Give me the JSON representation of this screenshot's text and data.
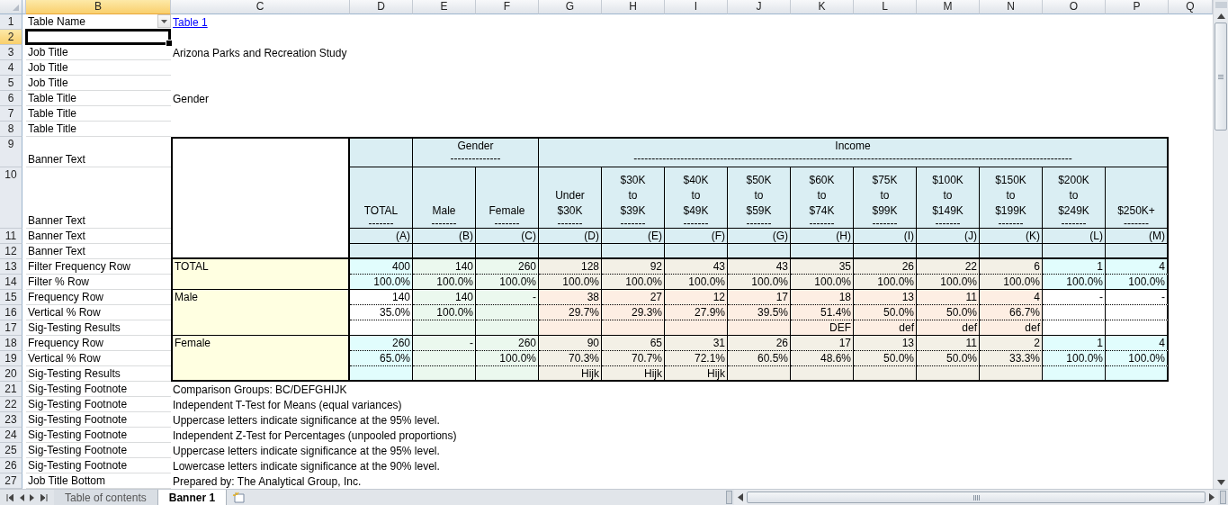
{
  "columns": [
    {
      "label": "B",
      "selected": true
    },
    {
      "label": "C",
      "selected": false
    },
    {
      "label": "D",
      "selected": false
    },
    {
      "label": "E",
      "selected": false
    },
    {
      "label": "F",
      "selected": false
    },
    {
      "label": "G",
      "selected": false
    },
    {
      "label": "H",
      "selected": false
    },
    {
      "label": "I",
      "selected": false
    },
    {
      "label": "J",
      "selected": false
    },
    {
      "label": "K",
      "selected": false
    },
    {
      "label": "L",
      "selected": false
    },
    {
      "label": "M",
      "selected": false
    },
    {
      "label": "N",
      "selected": false
    },
    {
      "label": "O",
      "selected": false
    },
    {
      "label": "P",
      "selected": false
    },
    {
      "label": "Q",
      "selected": false
    }
  ],
  "rows": [
    {
      "number": "1",
      "selected": false,
      "label": "Table Name",
      "dropdown": true,
      "note": "Table 1",
      "link": true
    },
    {
      "number": "2",
      "selected": true
    },
    {
      "number": "3",
      "selected": false,
      "label": "Job Title",
      "note": "Arizona Parks and Recreation Study"
    },
    {
      "number": "4",
      "selected": false,
      "label": "Job Title"
    },
    {
      "number": "5",
      "selected": false,
      "label": "Job Title"
    },
    {
      "number": "6",
      "selected": false,
      "label": "Table Title",
      "note": "Gender"
    },
    {
      "number": "7",
      "selected": false,
      "label": "Table Title"
    },
    {
      "number": "8",
      "selected": false,
      "label": "Table Title"
    },
    {
      "number": "9",
      "selected": false,
      "label": "Banner Text"
    },
    {
      "number": "10",
      "selected": false,
      "label": "Banner Text"
    },
    {
      "number": "11",
      "selected": false,
      "label": "Banner Text"
    },
    {
      "number": "12",
      "selected": false,
      "label": "Banner Text"
    },
    {
      "number": "13",
      "selected": false,
      "label": "Filter Frequency Row"
    },
    {
      "number": "14",
      "selected": false,
      "label": "Filter % Row"
    },
    {
      "number": "15",
      "selected": false,
      "label": "Frequency Row"
    },
    {
      "number": "16",
      "selected": false,
      "label": "Vertical % Row"
    },
    {
      "number": "17",
      "selected": false,
      "label": "Sig-Testing Results"
    },
    {
      "number": "18",
      "selected": false,
      "label": "Frequency Row"
    },
    {
      "number": "19",
      "selected": false,
      "label": "Vertical % Row"
    },
    {
      "number": "20",
      "selected": false,
      "label": "Sig-Testing Results"
    },
    {
      "number": "21",
      "selected": false,
      "label": "Sig-Testing Footnote",
      "note": "Comparison Groups: BC/DEFGHIJK"
    },
    {
      "number": "22",
      "selected": false,
      "label": "Sig-Testing Footnote",
      "note": "Independent T-Test for Means (equal variances)"
    },
    {
      "number": "23",
      "selected": false,
      "label": "Sig-Testing Footnote",
      "note": "Uppercase letters indicate significance at the 95% level."
    },
    {
      "number": "24",
      "selected": false,
      "label": "Sig-Testing Footnote",
      "note": "Independent Z-Test for Percentages (unpooled proportions)"
    },
    {
      "number": "25",
      "selected": false,
      "label": "Sig-Testing Footnote",
      "note": "Uppercase letters indicate significance at the 95% level."
    },
    {
      "number": "26",
      "selected": false,
      "label": "Sig-Testing Footnote",
      "note": "Lowercase letters indicate significance at the 90% level."
    },
    {
      "number": "27",
      "selected": false,
      "label": "Job Title Bottom",
      "note": "Prepared by: The Analytical Group, Inc."
    }
  ],
  "banner_table": {
    "groups": [
      {
        "columns": [
          {
            "lines": [
              "TOTAL"
            ],
            "rule": "-------",
            "letter": "(A)"
          }
        ]
      },
      {
        "label": "Gender",
        "rule": "--------------",
        "columns": [
          {
            "lines": [
              "Male"
            ],
            "rule": "-------",
            "letter": "(B)"
          },
          {
            "lines": [
              "Female"
            ],
            "rule": "-------",
            "letter": "(C)"
          }
        ]
      },
      {
        "label": "Income",
        "rule": "--------------------------------------------------------------------------------------------------------------------------",
        "columns": [
          {
            "lines": [
              "Under",
              "$30K"
            ],
            "rule": "-------",
            "letter": "(D)"
          },
          {
            "lines": [
              "$30K",
              "to",
              "$39K"
            ],
            "rule": "-------",
            "letter": "(E)"
          },
          {
            "lines": [
              "$40K",
              "to",
              "$49K"
            ],
            "rule": "-------",
            "letter": "(F)"
          },
          {
            "lines": [
              "$50K",
              "to",
              "$59K"
            ],
            "rule": "-------",
            "letter": "(G)"
          },
          {
            "lines": [
              "$60K",
              "to",
              "$74K"
            ],
            "rule": "-------",
            "letter": "(H)"
          },
          {
            "lines": [
              "$75K",
              "to",
              "$99K"
            ],
            "rule": "-------",
            "letter": "(I)"
          },
          {
            "lines": [
              "$100K",
              "to",
              "$149K"
            ],
            "rule": "-------",
            "letter": "(J)"
          },
          {
            "lines": [
              "$150K",
              "to",
              "$199K"
            ],
            "rule": "-------",
            "letter": "(K)"
          },
          {
            "lines": [
              "$200K",
              "to",
              "$249K"
            ],
            "rule": "-------",
            "letter": "(L)"
          },
          {
            "lines": [
              "$250K+"
            ],
            "rule": "-------",
            "letter": "(M)"
          }
        ]
      }
    ],
    "sections": [
      {
        "label": "TOTAL",
        "rows": [
          [
            "400",
            "140",
            "260",
            "128",
            "92",
            "43",
            "43",
            "35",
            "26",
            "22",
            "6",
            "1",
            "4"
          ],
          [
            "100.0%",
            "100.0%",
            "100.0%",
            "100.0%",
            "100.0%",
            "100.0%",
            "100.0%",
            "100.0%",
            "100.0%",
            "100.0%",
            "100.0%",
            "100.0%",
            "100.0%"
          ]
        ]
      },
      {
        "label": "Male",
        "rows": [
          [
            "140",
            "140",
            "-",
            "38",
            "27",
            "12",
            "17",
            "18",
            "13",
            "11",
            "4",
            "-",
            "-"
          ],
          [
            "35.0%",
            "100.0%",
            null,
            "29.7%",
            "29.3%",
            "27.9%",
            "39.5%",
            "51.4%",
            "50.0%",
            "50.0%",
            "66.7%",
            null,
            null
          ],
          [
            null,
            null,
            null,
            null,
            null,
            null,
            null,
            "DEF",
            "def",
            "def",
            "def",
            null,
            null
          ]
        ]
      },
      {
        "label": "Female",
        "rows": [
          [
            "260",
            "-",
            "260",
            "90",
            "65",
            "31",
            "26",
            "17",
            "13",
            "11",
            "2",
            "1",
            "4"
          ],
          [
            "65.0%",
            null,
            "100.0%",
            "70.3%",
            "70.7%",
            "72.1%",
            "60.5%",
            "48.6%",
            "50.0%",
            "50.0%",
            "33.3%",
            "100.0%",
            "100.0%"
          ],
          [
            null,
            null,
            null,
            "Hijk",
            "Hijk",
            "Hijk",
            null,
            null,
            null,
            null,
            null,
            null,
            null
          ]
        ]
      }
    ]
  },
  "sheet_tabs": [
    {
      "label": "Table of contents",
      "selected": false
    },
    {
      "label": "Banner 1",
      "selected": true
    }
  ]
}
